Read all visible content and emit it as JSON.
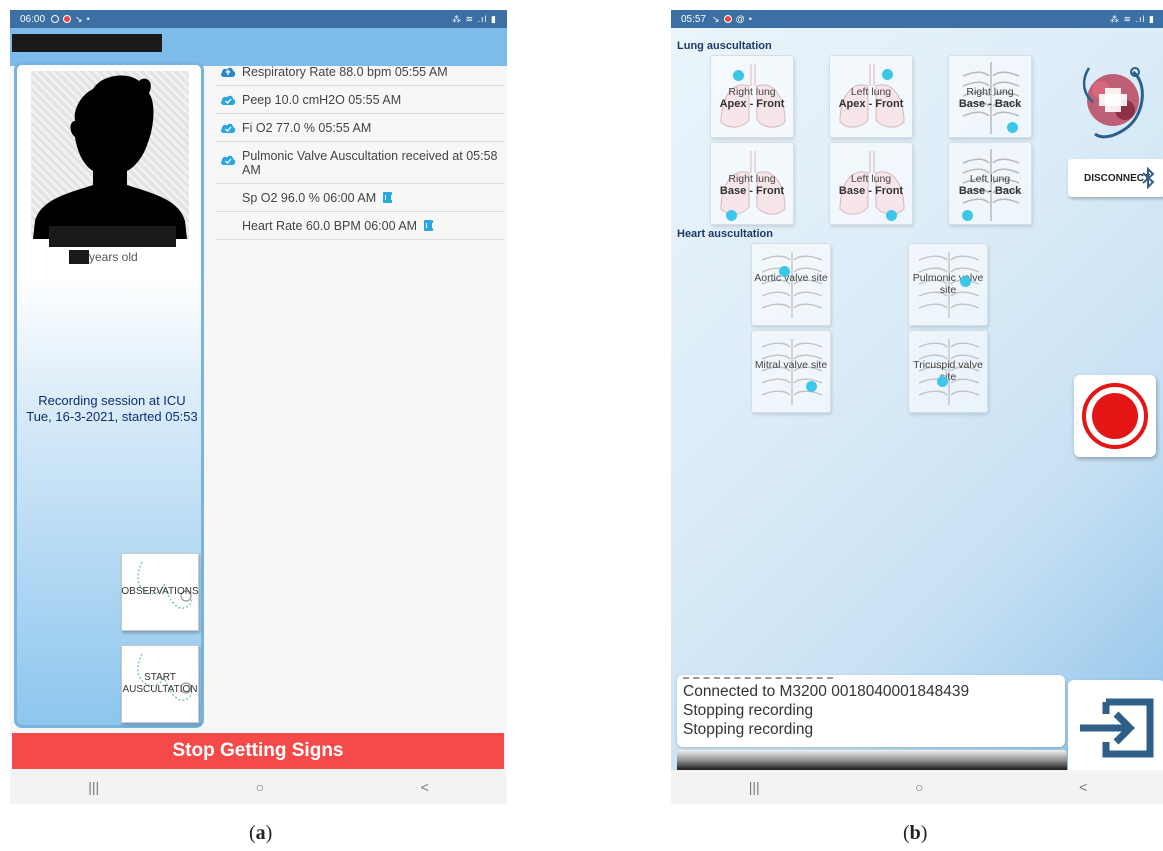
{
  "panel_a": {
    "status": {
      "time": "06:00",
      "right": "⁂ ≋ .ıl ▮"
    },
    "patient": {
      "age_suffix": "years old"
    },
    "session": {
      "line1": "Recording session at ICU",
      "line2": "Tue, 16-3-2021, started 05:53"
    },
    "buttons": {
      "observations": "OBSERVATIONS",
      "start_auscultation_1": "START",
      "start_auscultation_2": "AUSCULTATION"
    },
    "vitals": [
      {
        "text": "Respiratory Rate 88.0 bpm 05:55 AM",
        "icon": "cloud-upload-icon"
      },
      {
        "text": "Peep 10.0 cmH2O 05:55 AM",
        "icon": "cloud-done-icon"
      },
      {
        "text": "Fi O2 77.0 % 05:55 AM",
        "icon": "cloud-done-icon"
      },
      {
        "text": "Pulmonic Valve Auscultation received at 05:58 AM",
        "icon": "cloud-done-icon"
      },
      {
        "text": "Sp O2 96.0 % 06:00 AM",
        "icon": "trash-icon"
      },
      {
        "text": "Heart Rate 60.0 BPM 06:00 AM",
        "icon": "trash-icon"
      }
    ],
    "stop_button": "Stop Getting Signs",
    "nav": {
      "recent": "|||",
      "home": "○",
      "back": "<"
    },
    "colors": {
      "app_bar": "#7dbbea",
      "stop": "#f44a4a",
      "session_text": "#0e2f6e",
      "status_icon": "#2aa7e0"
    }
  },
  "panel_b": {
    "status": {
      "time": "05:57",
      "right": "⁂ ≋ .ıl ▮"
    },
    "lung_label": "Lung auscultation",
    "lung_sites": [
      {
        "l1": "Right lung",
        "l2": "Apex - Front"
      },
      {
        "l1": "Left lung",
        "l2": "Apex - Front"
      },
      {
        "l1": "Right lung",
        "l2": "Base - Back"
      },
      {
        "l1": "Right lung",
        "l2": "Base - Front"
      },
      {
        "l1": "Left lung",
        "l2": "Base - Front"
      },
      {
        "l1": "Left lung",
        "l2": "Base - Back"
      }
    ],
    "heart_label": "Heart auscultation",
    "heart_sites": [
      {
        "name": "Aortic valve site"
      },
      {
        "name": "Pulmonic valve site"
      },
      {
        "name": "Mitral valve site"
      },
      {
        "name": "Tricuspid valve site"
      }
    ],
    "disconnect": "DISCONNECT",
    "log_lines": [
      "Connected to M3200 0018040001848439",
      "Stopping recording",
      "Stopping recording"
    ],
    "nav": {
      "recent": "|||",
      "home": "○",
      "back": "<"
    },
    "colors": {
      "record": "#e31515",
      "site_point": "#3cc6e8",
      "exit_arrow": "#2f5f86"
    }
  },
  "captions": {
    "a": "a",
    "b": "b"
  }
}
